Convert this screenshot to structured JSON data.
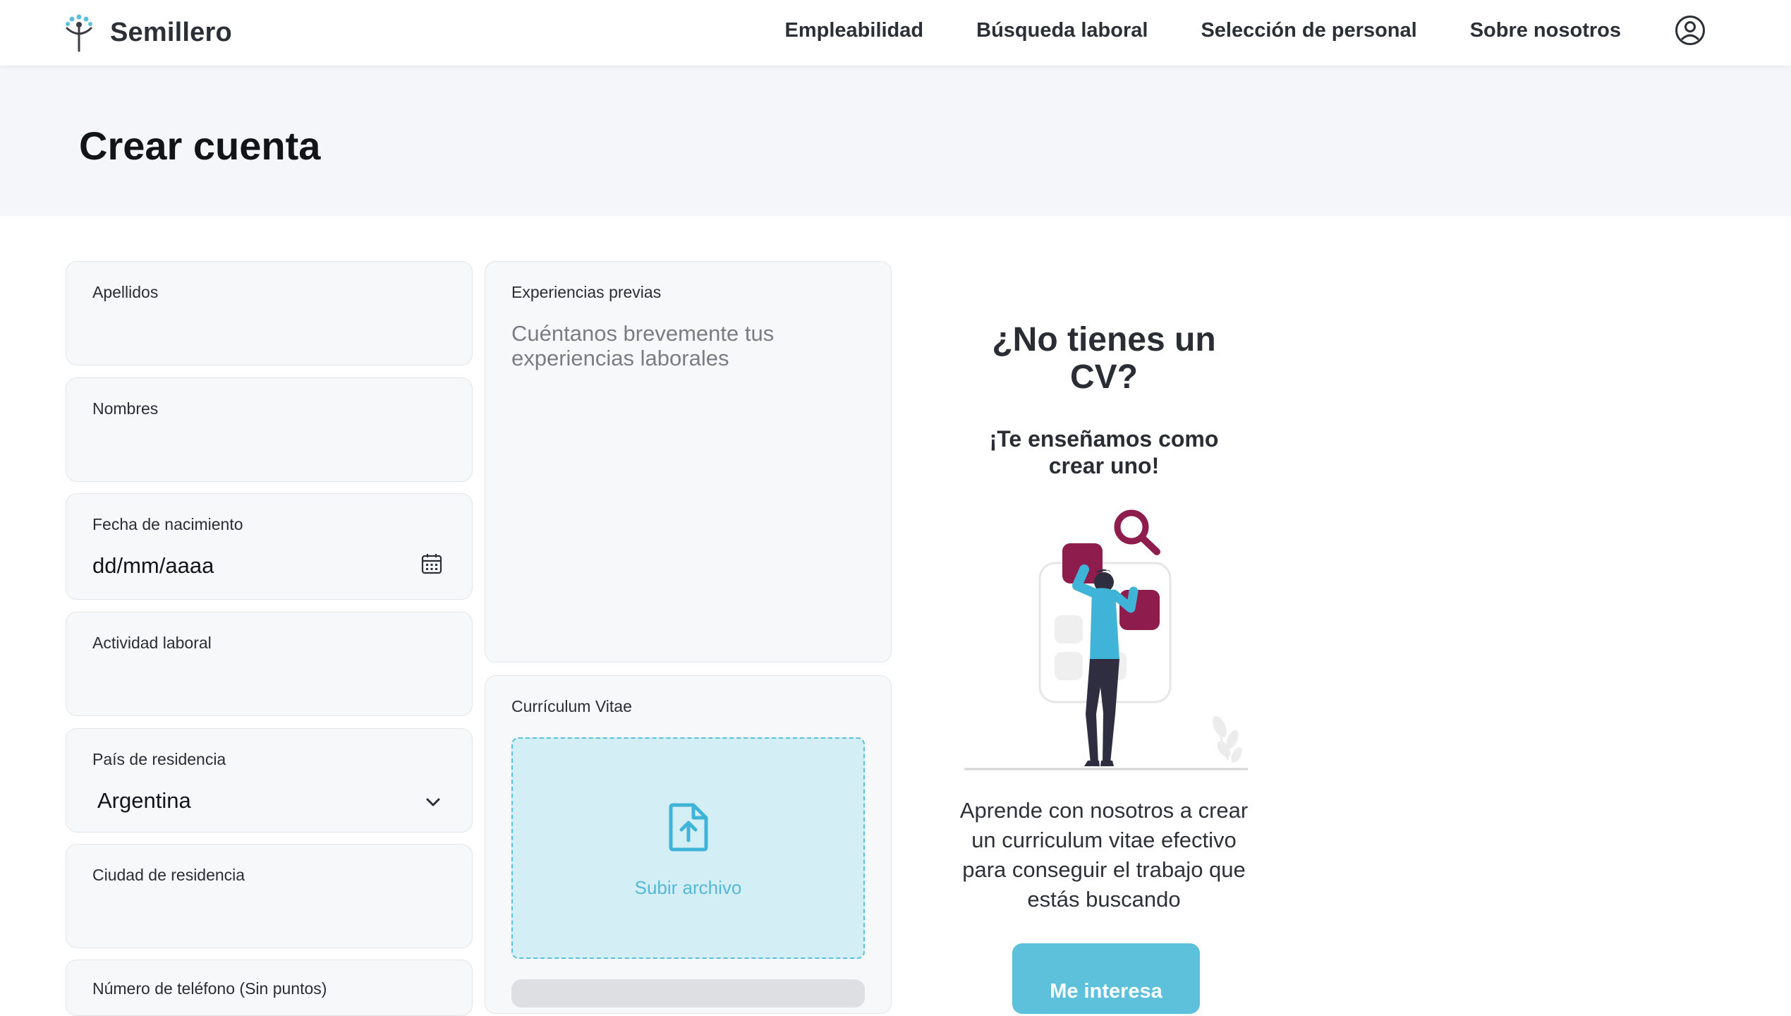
{
  "brand": {
    "name": "Semillero"
  },
  "nav": {
    "links": [
      "Empleabilidad",
      "Búsqueda laboral",
      "Selección de personal",
      "Sobre nosotros"
    ]
  },
  "page": {
    "title": "Crear cuenta"
  },
  "form": {
    "apellidos": {
      "label": "Apellidos",
      "value": ""
    },
    "nombres": {
      "label": "Nombres",
      "value": ""
    },
    "fecha_nacimiento": {
      "label": "Fecha de nacimiento",
      "value": "dd/mm/aaaa"
    },
    "actividad_laboral": {
      "label": "Actividad laboral",
      "value": ""
    },
    "pais_residencia": {
      "label": "País de residencia",
      "value": "Argentina"
    },
    "ciudad_residencia": {
      "label": "Ciudad de residencia",
      "value": ""
    },
    "telefono": {
      "label": "Número de teléfono (Sin puntos)",
      "value": ""
    },
    "experiencias": {
      "label": "Experiencias previas",
      "placeholder": "Cuéntanos brevemente tus experiencias laborales"
    },
    "cv": {
      "label": "Currículum Vitae",
      "upload_label": "Subir archivo"
    }
  },
  "promo": {
    "title": "¿No tienes un CV?",
    "subtitle": "¡Te enseñamos como crear uno!",
    "description": "Aprende con nosotros a crear un curriculum vitae efectivo para conseguir el trabajo que estás buscando",
    "button_label": "Me interesa"
  },
  "colors": {
    "accent": "#5ec1dc",
    "illustration_magenta": "#8e1c4c",
    "illustration_blue": "#3fb4d8",
    "illustration_navy": "#2f2e41"
  },
  "icons": {
    "brand": "sprout-person-icon",
    "user": "user-circle-icon",
    "date": "calendar-icon",
    "select": "chevron-down-icon",
    "upload": "file-upload-icon"
  }
}
